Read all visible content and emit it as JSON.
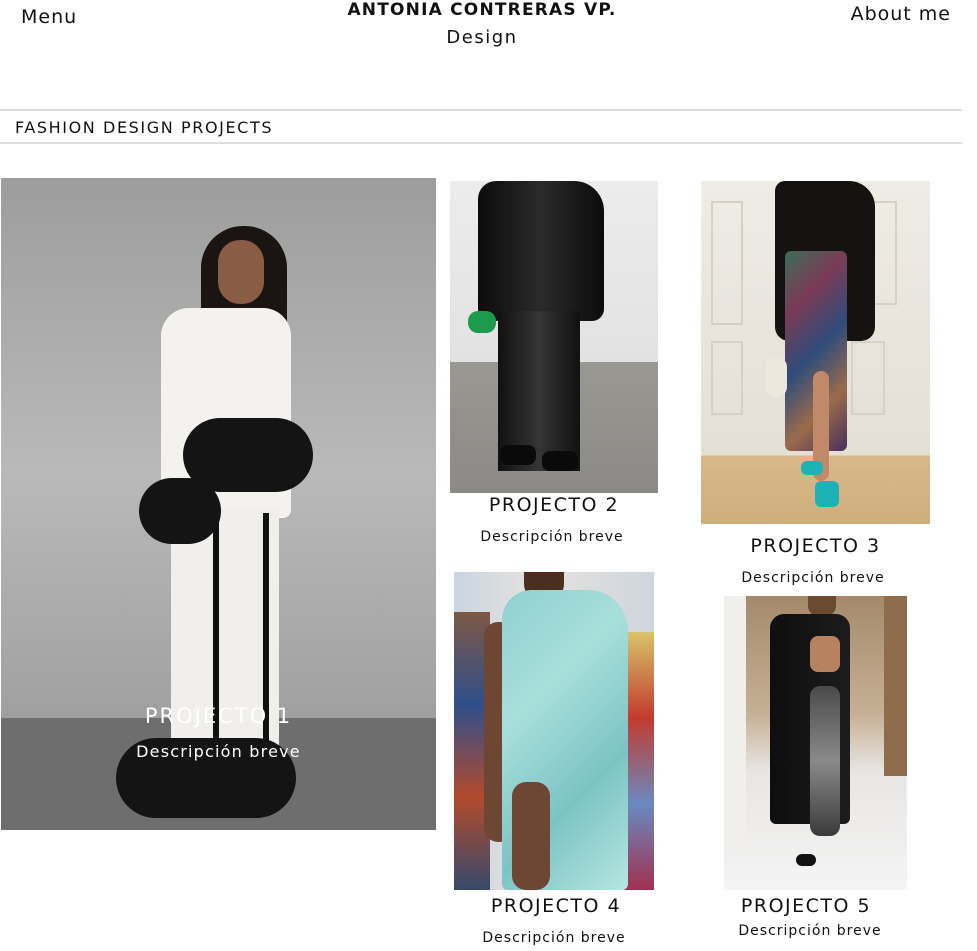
{
  "header": {
    "menu_label": "Menu",
    "brand_name": "ANTONIA CONTRERAS VP.",
    "brand_subtitle": "Design",
    "about_label": "About me"
  },
  "section": {
    "title": "FASHION DESIGN PROJECTS"
  },
  "projects": [
    {
      "title": "PROJECTO 1",
      "description": "Descripción breve",
      "image": "white-suit-feather-trim-photo"
    },
    {
      "title": "PROJECTO 2",
      "description": "Descripción breve",
      "image": "black-sequin-outfit-photo"
    },
    {
      "title": "PROJECTO 3",
      "description": "Descripción breve",
      "image": "blazer-sequin-skirt-photo"
    },
    {
      "title": "PROJECTO 4",
      "description": "Descripción breve",
      "image": "aqua-crystal-dress-photo"
    },
    {
      "title": "PROJECTO 5",
      "description": "Descripción breve",
      "image": "black-sequin-jumpsuit-photo"
    }
  ]
}
